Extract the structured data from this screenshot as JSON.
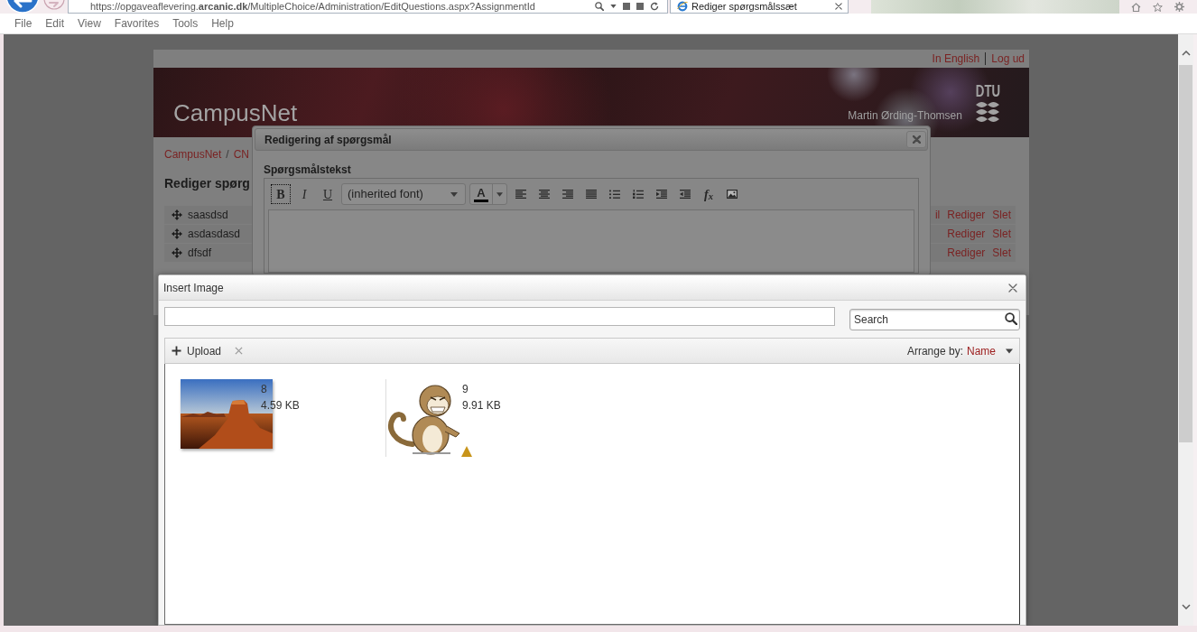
{
  "browser": {
    "address": "https://opgaveaflevering.**arcanic.dk**/MultipleChoice/Administration/EditQuestions.aspx?AssignmentId",
    "tab_title": "Rediger spørgsmålssæt"
  },
  "menu_bar": [
    "File",
    "Edit",
    "View",
    "Favorites",
    "Tools",
    "Help"
  ],
  "page": {
    "top_links": [
      "In English",
      "Log ud"
    ],
    "site_title": "CampusNet",
    "user_name": "Martin Ørding-Thomsen",
    "logo_text": "DTU",
    "breadcrumb": [
      "CampusNet",
      "CN"
    ],
    "breadcrumb_separator": "/",
    "heading": "Rediger spørg",
    "questions": [
      {
        "label": "saasdsd",
        "column_2": "il",
        "actions": [
          "Rediger",
          "Slet"
        ]
      },
      {
        "label": "asdasdasd",
        "actions": [
          "Rediger",
          "Slet"
        ]
      },
      {
        "label": "dfsdf",
        "actions": [
          "Rediger",
          "Slet"
        ]
      }
    ]
  },
  "question_dialog": {
    "title": "Redigering af spørgsmål",
    "field_label": "Spørgsmålstekst",
    "toolbar": [
      {
        "kind": "bold",
        "label": "B",
        "focused": true
      },
      {
        "kind": "italic",
        "label": "I",
        "focused": false
      },
      {
        "kind": "underline",
        "label": "U",
        "focused": false
      },
      {
        "kind": "font",
        "value": "(inherited font)",
        "focused": false
      },
      {
        "kind": "color",
        "label": "A",
        "focused": false
      },
      {
        "kind": "alignleft",
        "focused": false
      },
      {
        "kind": "aligncenter",
        "focused": false
      },
      {
        "kind": "alignright",
        "focused": false
      },
      {
        "kind": "justify",
        "focused": false
      },
      {
        "kind": "bullets",
        "focused": false
      },
      {
        "kind": "numbering",
        "focused": false
      },
      {
        "kind": "indent",
        "focused": false
      },
      {
        "kind": "outdent",
        "focused": false
      },
      {
        "kind": "formula",
        "label": "f$_{x}$",
        "focused": false
      },
      {
        "kind": "image",
        "focused": false
      }
    ]
  },
  "image_dialog": {
    "title": "Insert Image",
    "search": {
      "placeholder": "Search"
    },
    "upload": "Upload",
    "arrange_label": "Arrange by:",
    "arrange_value": "Name",
    "files": [
      {
        "kind": "photo",
        "name": "8",
        "size": "4.59 KB"
      },
      {
        "kind": "cartoon",
        "name": "9",
        "size": "9.91 KB"
      }
    ]
  }
}
